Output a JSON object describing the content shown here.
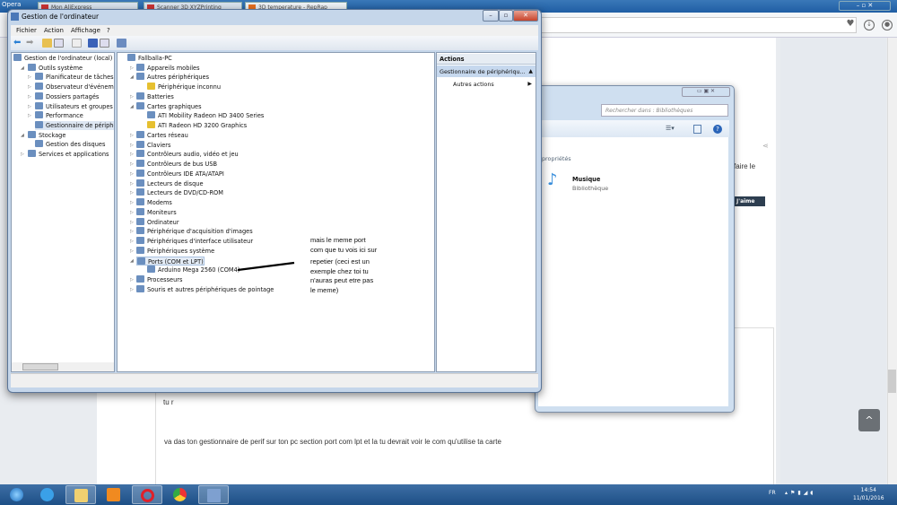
{
  "browser": {
    "app_label": "Opera",
    "tabs": [
      "Mon AliExpress",
      "Scanner 3D XYZPrinting",
      "3D temperature - RepRap"
    ]
  },
  "webpage": {
    "partial_text_right": "faire le",
    "like_button": "J'aime",
    "partial_text_left": "tu r",
    "post_text": "va das ton gestionnaire de perif sur ton pc section port com lpt et la tu devrait voir le com qu'utilise ta carte",
    "scroll_top_icon": "^"
  },
  "library_window": {
    "search_placeholder": "Rechercher dans : Bibliothèques",
    "section_partial": "propriétés",
    "item_name": "Musique",
    "item_type": "Bibliothèque"
  },
  "window": {
    "title": "Gestion de l'ordinateur",
    "menu": [
      "Fichier",
      "Action",
      "Affichage",
      "?"
    ]
  },
  "left_tree": [
    "Gestion de l'ordinateur (local)",
    "Outils système",
    "Planificateur de tâches",
    "Observateur d'événements",
    "Dossiers partagés",
    "Utilisateurs et groupes locaux",
    "Performance",
    "Gestionnaire de périphériques",
    "Stockage",
    "Gestion des disques",
    "Services et applications"
  ],
  "device_tree": {
    "root": "Fallballa-PC",
    "items": [
      "Appareils mobiles",
      "Autres périphériques",
      "Périphérique inconnu",
      "Batteries",
      "Cartes graphiques",
      "ATI Mobility Radeon HD 3400 Series",
      "ATI Radeon HD 3200 Graphics",
      "Cartes réseau",
      "Claviers",
      "Contrôleurs audio, vidéo et jeu",
      "Contrôleurs de bus USB",
      "Contrôleurs IDE ATA/ATAPI",
      "Lecteurs de disque",
      "Lecteurs de DVD/CD-ROM",
      "Modems",
      "Moniteurs",
      "Ordinateur",
      "Périphérique d'acquisition d'images",
      "Périphériques d'interface utilisateur",
      "Périphériques système",
      "Ports (COM et LPT)",
      "Arduino Mega 2560 (COM4)",
      "Processeurs",
      "Souris et autres périphériques de pointage"
    ]
  },
  "annotation": [
    "mais le meme port",
    "com que tu vois ici sur",
    "repetier (ceci est un",
    "exemple chez toi tu",
    "n'auras peut etre pas",
    "le meme)"
  ],
  "actions": {
    "header": "Actions",
    "selected": "Gestionnaire de périphériqu...",
    "more": "Autres actions"
  },
  "taskbar": {
    "lang": "FR",
    "time": "14:54",
    "date": "11/01/2016"
  }
}
